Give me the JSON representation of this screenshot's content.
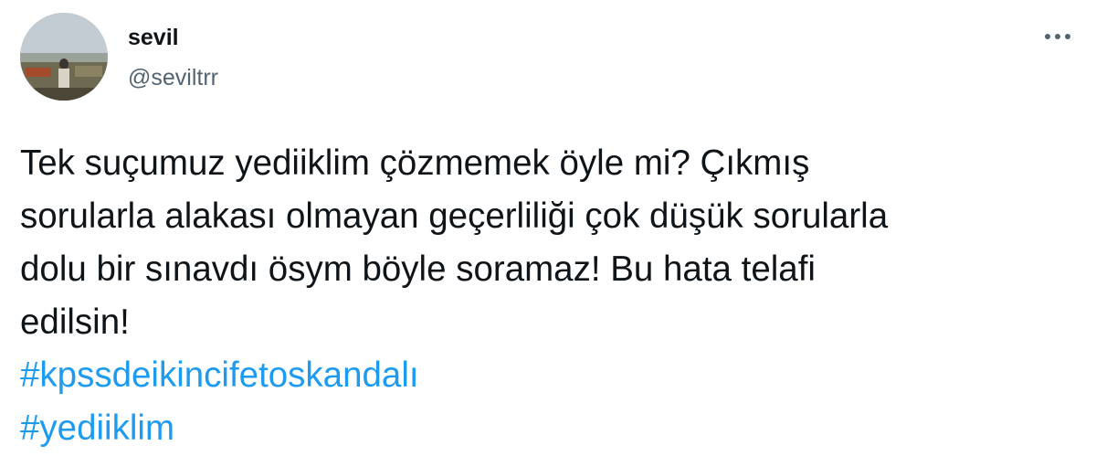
{
  "tweet": {
    "author": {
      "display_name": "sevil",
      "handle": "@seviltrr"
    },
    "text_lines": [
      "Tek suçumuz yediiklim çözmemek öyle mi? Çıkmış",
      "sorularla alakası olmayan geçerliliği çok düşük sorularla",
      "dolu bir sınavdı ösym böyle soramaz! Bu hata telafi",
      "edilsin!"
    ],
    "hashtags": [
      "#kpssdeikincifetoskandalı",
      "#yediiklim"
    ],
    "hashtag_color": "#1d9bf0",
    "text_color": "#0f1419",
    "secondary_color": "#536471",
    "more_icon": "more-horizontal-icon"
  }
}
